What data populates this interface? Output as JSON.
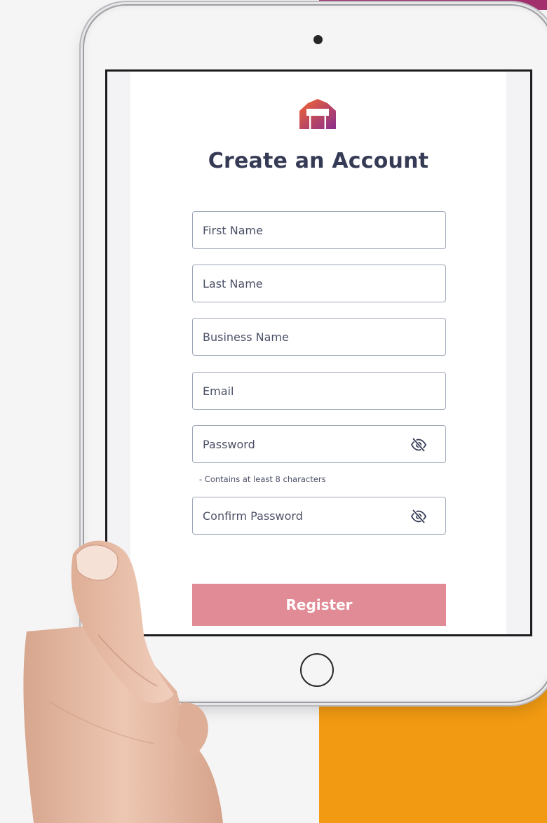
{
  "page": {
    "title": "Create an Account"
  },
  "form": {
    "fields": [
      {
        "name": "first-name",
        "placeholder": "First Name",
        "value": ""
      },
      {
        "name": "last-name",
        "placeholder": "Last Name",
        "value": ""
      },
      {
        "name": "business-name",
        "placeholder": "Business Name",
        "value": ""
      },
      {
        "name": "email",
        "placeholder": "Email",
        "value": ""
      },
      {
        "name": "password",
        "placeholder": "Password",
        "value": ""
      },
      {
        "name": "confirm-password",
        "placeholder": "Confirm Password",
        "value": ""
      }
    ],
    "password_hint": "- Contains at least 8 characters",
    "register_label": "Register"
  },
  "icons": {
    "logo": "house-logo-icon",
    "password_toggle": "eye-off-icon",
    "confirm_password_toggle": "eye-off-icon"
  },
  "colors": {
    "title_text": "#363b55",
    "register_button": "#e08b95",
    "logo_gradient_start": "#f2652f",
    "logo_gradient_end": "#8b2f8e",
    "background_magenta": "#a2306d",
    "background_orange": "#f19a12"
  }
}
